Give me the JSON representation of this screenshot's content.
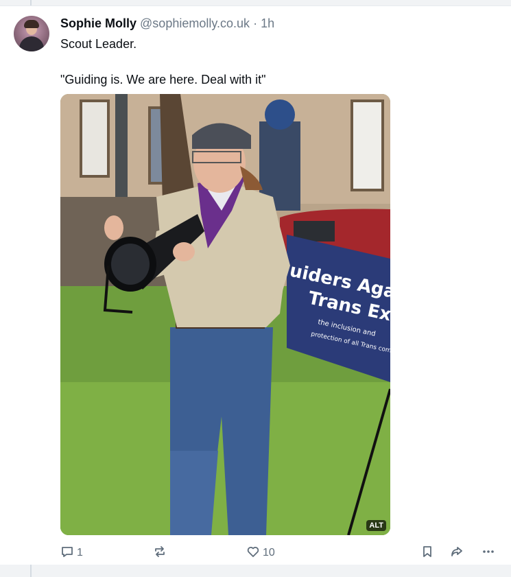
{
  "post": {
    "display_name": "Sophie Molly",
    "handle": "@sophiemolly.co.uk",
    "separator": "·",
    "time": "1h",
    "text_line1": "Scout Leader.",
    "text_line2": "\"Guiding is. We are here. Deal with it\"",
    "image_alt_badge": "ALT"
  },
  "actions": {
    "reply_count": "1",
    "repost_count": "",
    "like_count": "10"
  },
  "icons": {
    "reply": "reply-icon",
    "repost": "repost-icon",
    "like": "heart-icon",
    "bookmark": "bookmark-icon",
    "share": "share-icon",
    "more": "more-icon"
  },
  "colors": {
    "text_primary": "#0b0f14",
    "text_secondary": "#6b7886",
    "icon": "#5f6d7b",
    "background": "#f1f3f5"
  },
  "banner_text": {
    "line1": "uiders Agai",
    "line2": "Trans Exclusi",
    "line3": "the inclusion and",
    "line4": "protection of all Trans commun"
  }
}
